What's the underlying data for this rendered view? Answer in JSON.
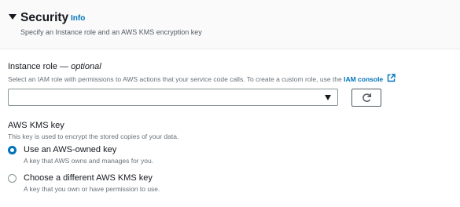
{
  "section": {
    "title": "Security",
    "info_link": "Info",
    "description": "Specify an Instance role and an AWS KMS encryption key"
  },
  "instance_role": {
    "label": "Instance role",
    "label_suffix": "— optional",
    "help_text": "Select an IAM role with permissions to AWS actions that your service code calls. To create a custom role, use the",
    "help_link": "IAM console",
    "selected_value": ""
  },
  "kms": {
    "label": "AWS KMS key",
    "help_text": "This key is used to encrypt the stored copies of your data.",
    "options": [
      {
        "label": "Use an AWS-owned key",
        "description": "A key that AWS owns and manages for you.",
        "selected": true
      },
      {
        "label": "Choose a different AWS KMS key",
        "description": "A key that you own or have permission to use.",
        "selected": false
      }
    ]
  },
  "colors": {
    "link": "#0073bb",
    "text": "#16191f",
    "muted": "#687078",
    "header_bg": "#fafafa"
  }
}
